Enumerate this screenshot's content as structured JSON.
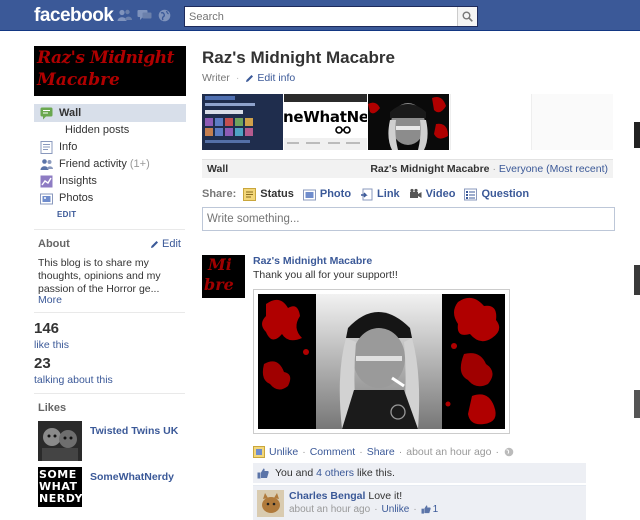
{
  "topbar": {
    "logo": "facebook",
    "search_placeholder": "Search"
  },
  "sidebar": {
    "profile_text_line1": "Raz's Midnight",
    "profile_text_line2": "Macabre",
    "items": [
      {
        "label": "Wall",
        "icon": "wall-icon",
        "selected": true
      },
      {
        "label": "Hidden posts",
        "icon": "",
        "sub": true
      },
      {
        "label": "Info",
        "icon": "info-icon"
      },
      {
        "label": "Friend activity",
        "count": "(1+)",
        "icon": "friends-icon"
      },
      {
        "label": "Insights",
        "icon": "insights-icon"
      },
      {
        "label": "Photos",
        "icon": "photos-icon"
      }
    ],
    "edit_label": "EDIT",
    "about": {
      "heading": "About",
      "edit_label": "Edit",
      "text": "This blog is to share my thoughts, opinions and my passion of the Horror ge...",
      "more_label": "More"
    },
    "stats": [
      {
        "num": "146",
        "label": "like this"
      },
      {
        "num": "23",
        "label": "talking about this"
      }
    ],
    "likes": {
      "heading": "Likes",
      "items": [
        {
          "name": "Twisted Twins UK"
        },
        {
          "name": "SomeWhatNerdy",
          "thumb_text": "SOME WHAT NERDY"
        }
      ]
    }
  },
  "main": {
    "title": "Raz's Midnight Macabre",
    "category": "Writer",
    "edit_info_label": "Edit info",
    "strip_text": "neWhatNe",
    "wall_bar": {
      "left": "Wall",
      "right_name": "Raz's Midnight Macabre",
      "right_sort": "Everyone (Most recent)"
    },
    "share": {
      "label": "Share:",
      "options": [
        {
          "label": "Status",
          "icon": "status-icon"
        },
        {
          "label": "Photo",
          "icon": "photo-icon"
        },
        {
          "label": "Link",
          "icon": "link-icon"
        },
        {
          "label": "Video",
          "icon": "video-icon"
        },
        {
          "label": "Question",
          "icon": "question-icon"
        }
      ]
    },
    "composer_placeholder": "Write something...",
    "post": {
      "author": "Raz's Midnight Macabre",
      "avatar_text_1": "Mi",
      "avatar_text_2": "bre",
      "text": "Thank you all for your support!!",
      "actions": {
        "unlike": "Unlike",
        "comment": "Comment",
        "share": "Share",
        "time": "about an hour ago"
      },
      "likes_prefix": "You and",
      "likes_link": "4 others",
      "likes_suffix": "like this.",
      "comment": {
        "author": "Charles Bengal",
        "text": "Love it!",
        "time": "about an hour ago",
        "unlike": "Unlike",
        "likes": "1"
      }
    }
  },
  "colors": {
    "brand": "#3b5998",
    "nav_selected": "#d8dfea",
    "blood": "#b00000"
  }
}
